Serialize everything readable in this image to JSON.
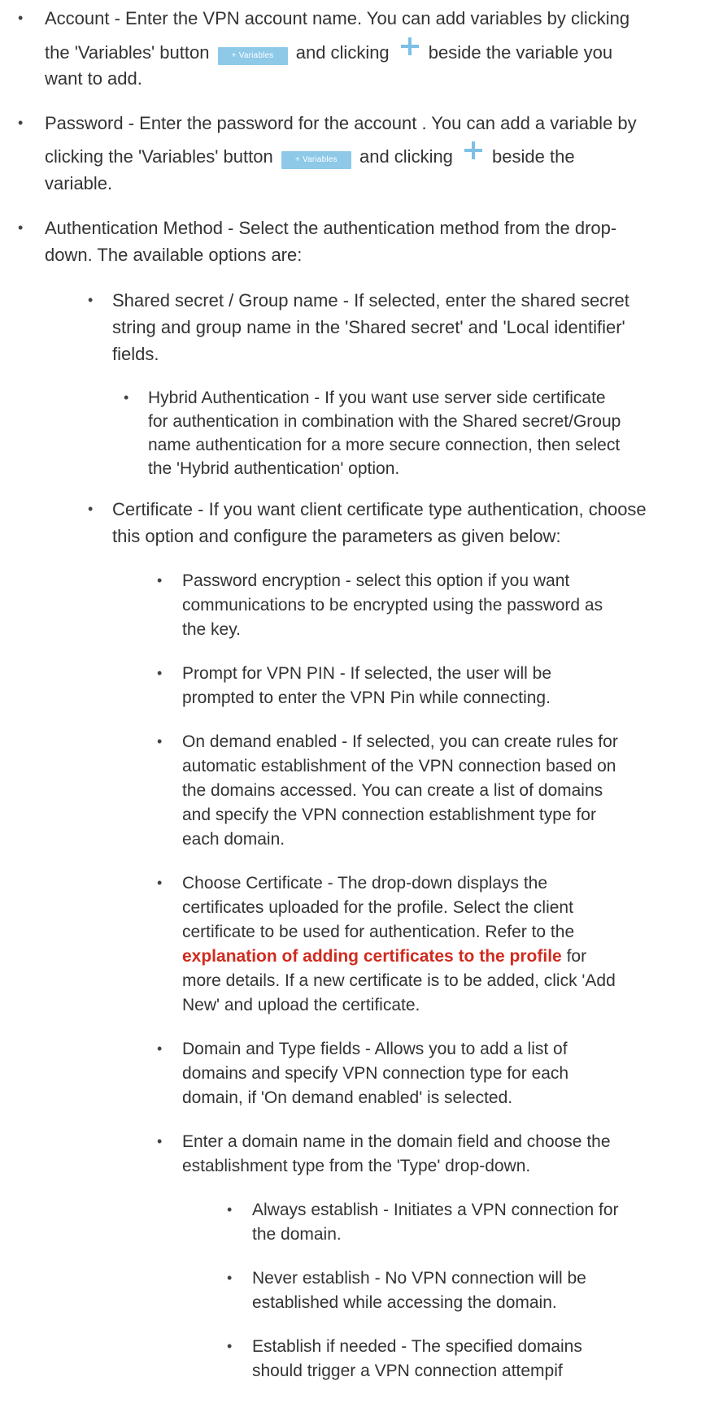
{
  "bullet_glyph": "•",
  "variables_button_label": "+ Variables",
  "plus_icon": "plus-icon",
  "items": {
    "account": {
      "line1": "Account - Enter the VPN account name. You can add variables by clicking",
      "line2_pre": "the 'Variables' button",
      "line2_mid": "and clicking",
      "line2_post": "beside the variable you",
      "line3": "want to add."
    },
    "password": {
      "line1": "Password - Enter the password for the account . You can add a variable by",
      "line2_pre": "clicking the 'Variables' button",
      "line2_mid": "and clicking",
      "line2_post": "beside the",
      "line3": "variable."
    },
    "auth_method": {
      "line1": "Authentication Method - Select the authentication method from the drop-",
      "line2": "down. The available options are:"
    },
    "shared_secret": {
      "line1": "Shared secret / Group name - If selected, enter the shared secret",
      "line2": "string and group name in the 'Shared secret' and 'Local identifier'",
      "line3": "fields."
    },
    "hybrid": {
      "line1": "Hybrid Authentication - If you want use server side certificate",
      "line2": "for authentication in combination with the Shared secret/Group",
      "line3": "name authentication for a more secure connection, then select",
      "line4": "the 'Hybrid authentication' option."
    },
    "certificate": {
      "line1": "Certificate - If you want client certificate type authentication, choose",
      "line2": "this option and configure the parameters as given below:"
    },
    "password_encryption": {
      "line1": "Password encryption - select this option if you want",
      "line2": "communications to be encrypted using the password as",
      "line3": "the key."
    },
    "prompt_pin": {
      "line1": "Prompt for VPN PIN - If selected, the user will be",
      "line2": "prompted to enter the VPN Pin while connecting."
    },
    "on_demand": {
      "line1": "On demand enabled - If selected, you can create rules for",
      "line2": "automatic establishment of the VPN connection based on",
      "line3": "the domains accessed. You can create a list of domains",
      "line4": "and specify the VPN connection establishment type for",
      "line5": "each domain."
    },
    "choose_cert": {
      "line1": "Choose Certificate - The drop-down displays the",
      "line2": "certificates uploaded for the profile. Select the client",
      "line3": "certificate to be used for authentication. Refer to the",
      "line4_link": "explanation of adding certificates to the profile",
      "line4_post": " for",
      "line5": "more details. If a new certificate is to be added, click 'Add",
      "line6": "New' and upload the certificate."
    },
    "domain_type": {
      "line1": "Domain and Type fields - Allows you to add a list of",
      "line2": "domains and specify VPN connection type for each",
      "line3": "domain, if 'On demand enabled' is selected."
    },
    "enter_domain": {
      "line1": "Enter a domain name in the domain field and choose the",
      "line2": "establishment type from the 'Type' drop-down."
    },
    "always": {
      "line1": "Always establish - Initiates a VPN connection for",
      "line2": "the domain."
    },
    "never": {
      "line1": "Never establish - No VPN connection will be",
      "line2": "established while accessing the domain."
    },
    "if_needed": {
      "line1": "Establish if needed - The specified domains",
      "line2": "should trigger a VPN connection attempif"
    }
  }
}
